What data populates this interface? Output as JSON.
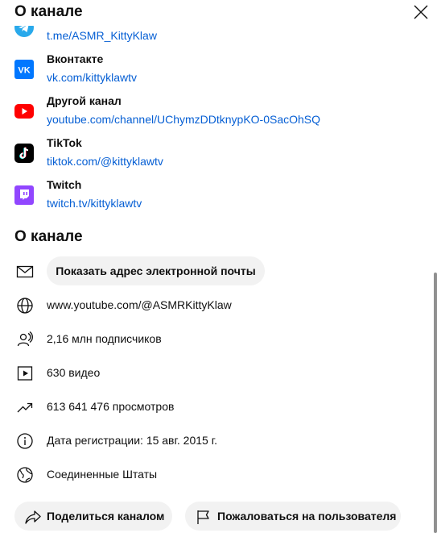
{
  "header": {
    "title": "О канале"
  },
  "links": [
    {
      "name": "",
      "url": "t.me/ASMR_KittyKlaw",
      "icon": "telegram-icon"
    },
    {
      "name": "Вконтакте",
      "url": "vk.com/kittyklawtv",
      "icon": "vk-icon"
    },
    {
      "name": "Другой канал",
      "url": "youtube.com/channel/UChymzDDtknypKO-0SacOhSQ",
      "icon": "youtube-icon"
    },
    {
      "name": "TikTok",
      "url": "tiktok.com/@kittyklawtv",
      "icon": "tiktok-icon"
    },
    {
      "name": "Twitch",
      "url": "twitch.tv/kittyklawtv",
      "icon": "twitch-icon"
    }
  ],
  "about": {
    "title": "О канале",
    "email_button": "Показать адрес электронной почты",
    "channel_url": "www.youtube.com/@ASMRKittyKlaw",
    "subscribers": "2,16 млн подписчиков",
    "videos": "630 видео",
    "views": "613 641 476 просмотров",
    "joined": "Дата регистрации: 15 авг. 2015 г.",
    "country": "Соединенные Штаты"
  },
  "actions": {
    "share": "Поделиться каналом",
    "report": "Пожаловаться на пользователя"
  },
  "colors": {
    "link": "#065fd4",
    "vk": "#0077ff",
    "youtube": "#ff0000",
    "tiktok": "#000000",
    "twitch": "#9146ff"
  }
}
